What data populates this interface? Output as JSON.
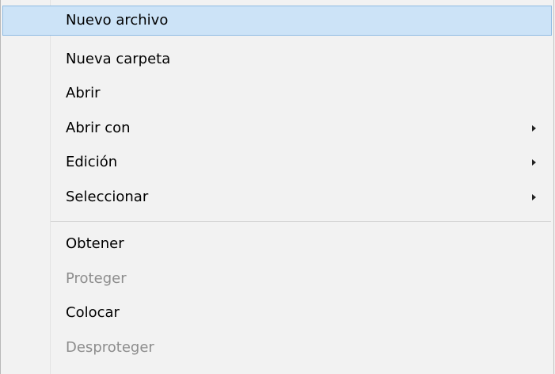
{
  "context_menu": {
    "items": [
      {
        "label": "Nuevo archivo",
        "highlighted": true,
        "disabled": false,
        "has_submenu": false
      },
      {
        "label": "Nueva carpeta",
        "highlighted": false,
        "disabled": false,
        "has_submenu": false
      },
      {
        "label": "Abrir",
        "highlighted": false,
        "disabled": false,
        "has_submenu": false
      },
      {
        "label": "Abrir con",
        "highlighted": false,
        "disabled": false,
        "has_submenu": true
      },
      {
        "label": "Edición",
        "highlighted": false,
        "disabled": false,
        "has_submenu": true
      },
      {
        "label": "Seleccionar",
        "highlighted": false,
        "disabled": false,
        "has_submenu": true
      },
      {
        "label": "Obtener",
        "highlighted": false,
        "disabled": false,
        "has_submenu": false
      },
      {
        "label": "Proteger",
        "highlighted": false,
        "disabled": true,
        "has_submenu": false
      },
      {
        "label": "Colocar",
        "highlighted": false,
        "disabled": false,
        "has_submenu": false
      },
      {
        "label": "Desproteger",
        "highlighted": false,
        "disabled": true,
        "has_submenu": false
      }
    ]
  },
  "colors": {
    "menu_background": "#f2f2f2",
    "highlight_fill": "#cce3f7",
    "highlight_border": "#8fbbe3",
    "disabled_text": "#8d8d8d",
    "text": "#000000"
  }
}
